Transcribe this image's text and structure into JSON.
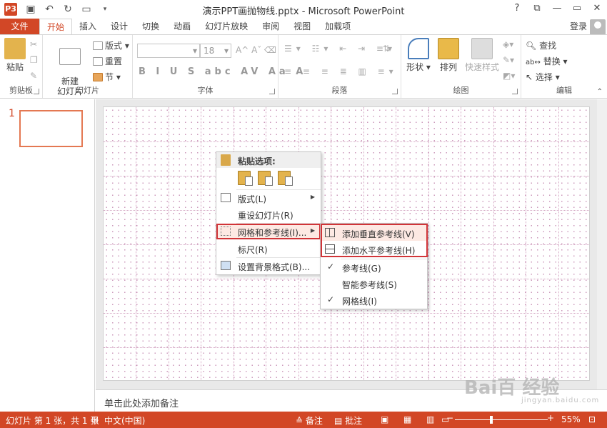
{
  "titlebar": {
    "app_icon": "P3",
    "title": "演示PPT画抛物线.pptx - Microsoft PowerPoint",
    "qat_icons": [
      "save-icon",
      "undo-icon",
      "redo-icon",
      "present-icon"
    ],
    "window_controls": [
      "?",
      "⧉",
      "—",
      "▭",
      "✕"
    ]
  },
  "tabs": {
    "file": "文件",
    "items": [
      "开始",
      "插入",
      "设计",
      "切换",
      "动画",
      "幻灯片放映",
      "审阅",
      "视图",
      "加载项"
    ],
    "active": "开始",
    "login": "登录"
  },
  "ribbon": {
    "clipboard": {
      "label": "剪贴板",
      "paste": "粘贴"
    },
    "slides": {
      "label": "幻灯片",
      "new_slide": "新建\n幻灯片",
      "layout": "版式",
      "reset": "重置",
      "section": "节"
    },
    "font": {
      "label": "字体",
      "size": "18",
      "format_row": "B I U S abc AV Aa A"
    },
    "paragraph": {
      "label": "段落"
    },
    "drawing": {
      "label": "绘图",
      "shapes": "形状",
      "arrange": "排列",
      "quick_styles": "快速样式"
    },
    "editing": {
      "label": "编辑",
      "find": "查找",
      "replace": "替换",
      "select": "选择"
    }
  },
  "thumbnails": {
    "slide_number": "1"
  },
  "context_menu": {
    "paste_header": "粘贴选项:",
    "items": [
      {
        "label": "版式(L)",
        "has_submenu": true,
        "icon": "layout-icon"
      },
      {
        "label": "重设幻灯片(R)",
        "has_submenu": false,
        "icon": ""
      },
      {
        "label": "网格和参考线(I)...",
        "has_submenu": true,
        "icon": "grid-icon",
        "highlighted": true
      },
      {
        "label": "标尺(R)",
        "has_submenu": false,
        "icon": ""
      },
      {
        "label": "设置背景格式(B)...",
        "has_submenu": false,
        "icon": "background-icon"
      }
    ]
  },
  "submenu": {
    "items": [
      {
        "label": "添加垂直参考线(V)",
        "icon": "vertical-guide-icon"
      },
      {
        "label": "添加水平参考线(H)",
        "icon": "horizontal-guide-icon"
      },
      {
        "label": "参考线(G)",
        "checked": true
      },
      {
        "label": "智能参考线(S)",
        "checked": false
      },
      {
        "label": "网格线(I)",
        "checked": true
      }
    ]
  },
  "notes": {
    "placeholder": "单击此处添加备注"
  },
  "statusbar": {
    "slide_info": "幻灯片 第 1 张，共 1 张",
    "language": "中文(中国)",
    "notes": "备注",
    "comments": "批注",
    "zoom": "55%"
  },
  "watermark": {
    "text": "Bai百 经验",
    "sub": "jingyan.baidu.com"
  },
  "colors": {
    "accent": "#d24726",
    "highlight_border": "#d13438",
    "grid_dot": "#cc99bb"
  }
}
